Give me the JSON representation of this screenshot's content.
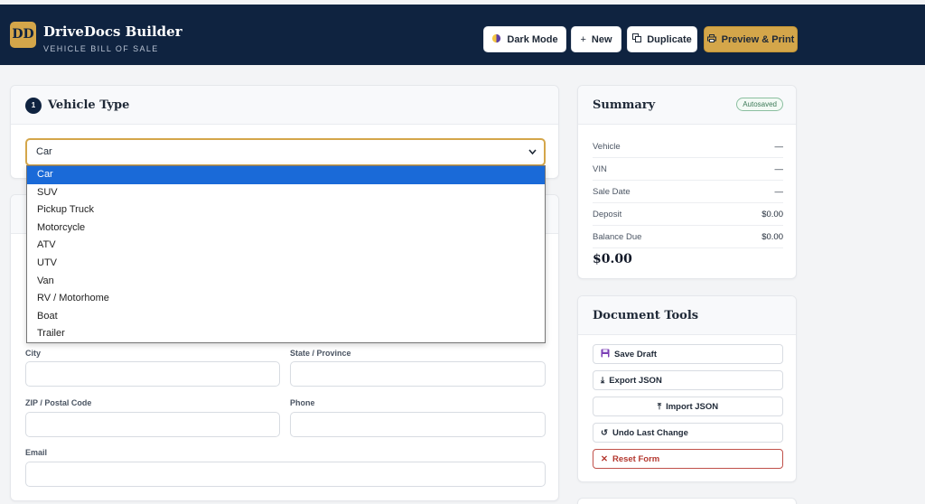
{
  "header": {
    "logo_text": "DD",
    "title": "DriveDocs Builder",
    "subtitle": "VEHICLE BILL OF SALE",
    "buttons": {
      "dark_mode": "Dark Mode",
      "new": "New",
      "duplicate": "Duplicate",
      "preview": "Preview & Print"
    }
  },
  "vehicle_type": {
    "step": "1",
    "title": "Vehicle Type",
    "selected": "Car",
    "options": [
      "Car",
      "SUV",
      "Pickup Truck",
      "Motorcycle",
      "ATV",
      "UTV",
      "Van",
      "RV / Motorhome",
      "Boat",
      "Trailer"
    ]
  },
  "contact_form": {
    "city_label": "City",
    "state_label": "State / Province",
    "zip_label": "ZIP / Postal Code",
    "phone_label": "Phone",
    "email_label": "Email",
    "city_value": "",
    "state_value": "",
    "zip_value": "",
    "phone_value": "",
    "email_value": ""
  },
  "summary": {
    "title": "Summary",
    "badge": "Autosaved",
    "rows": [
      {
        "label": "Vehicle",
        "value": "—"
      },
      {
        "label": "VIN",
        "value": "—"
      },
      {
        "label": "Sale Date",
        "value": "—"
      },
      {
        "label": "Deposit",
        "value": "$0.00"
      },
      {
        "label": "Balance Due",
        "value": "$0.00"
      }
    ],
    "total": "$0.00"
  },
  "tools": {
    "title": "Document Tools",
    "save_draft": "Save Draft",
    "export_json": "Export JSON",
    "import_json": "Import JSON",
    "undo": "Undo Last Change",
    "reset": "Reset Form"
  },
  "colors": {
    "navy": "#0f2340",
    "gold": "#d4a64a",
    "selection": "#1a6ad8",
    "danger": "#b4382f",
    "autosave_green": "#3c7a57"
  },
  "icons": {
    "dark_mode": "half-moon-icon",
    "new": "plus-icon",
    "duplicate": "copy-icon",
    "preview": "printer-icon",
    "save": "floppy-disk-icon",
    "export": "download-icon",
    "import": "upload-icon",
    "undo": "undo-icon",
    "reset": "close-icon"
  }
}
